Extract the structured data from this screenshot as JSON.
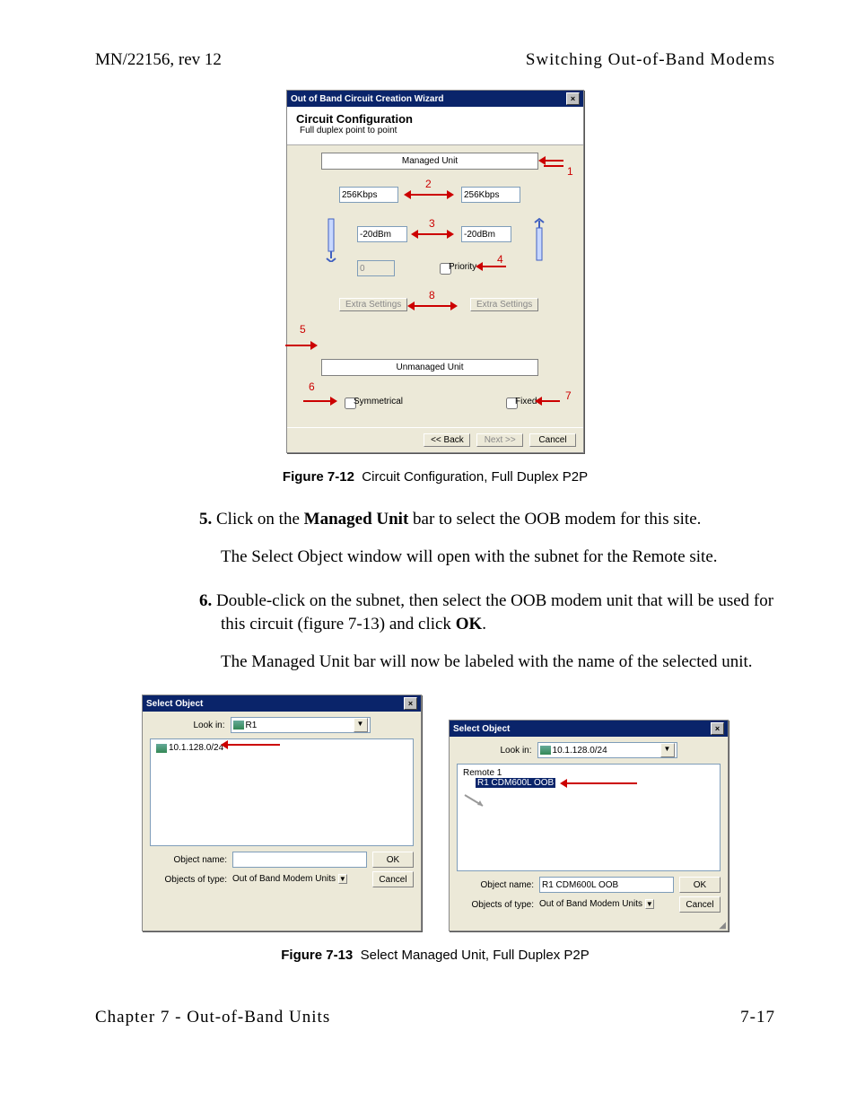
{
  "header": {
    "left": "MN/22156, rev 12",
    "right": "Switching Out-of-Band Modems"
  },
  "fig712": {
    "window_title": "Out of Band Circuit Creation Wizard",
    "title": "Circuit Configuration",
    "subtitle": "Full duplex point to point",
    "managed_unit_label": "Managed Unit",
    "unmanaged_unit_label": "Unmanaged Unit",
    "rate_left": "256Kbps",
    "rate_right": "256Kbps",
    "power_left": "-20dBm",
    "power_right": "-20dBm",
    "priority_value": "0",
    "priority_label": "Priority",
    "extra_left": "Extra Settings",
    "extra_right": "Extra Settings",
    "symmetrical_label": "Symmetrical",
    "fixed_label": "Fixed",
    "back_btn": "<< Back",
    "next_btn": "Next >>",
    "cancel_btn": "Cancel",
    "callouts": {
      "n1": "1",
      "n2": "2",
      "n3": "3",
      "n4": "4",
      "n5": "5",
      "n6": "6",
      "n7": "7",
      "n8": "8"
    }
  },
  "cap712": {
    "label": "Figure 7-12",
    "text": "Circuit Configuration, Full Duplex P2P"
  },
  "step5": {
    "num": "5.",
    "text_a": "Click on the ",
    "bold": "Managed Unit",
    "text_b": " bar to select the OOB modem for this site.",
    "follow": "The Select Object window will open with the subnet for the Remote site."
  },
  "step6": {
    "num": "6.",
    "text_a": "Double-click on the subnet, then select the OOB modem unit that will be used for this circuit (figure 7-13) and click ",
    "bold": "OK",
    "text_b": ".",
    "follow": "The Managed Unit bar will now be labeled with the name of the selected unit."
  },
  "fig713": {
    "window_title": "Select Object",
    "lookin_label": "Look in:",
    "left": {
      "lookin_value": "R1",
      "list_item": "10.1.128.0/24",
      "object_name_label": "Object name:",
      "object_name_value": "",
      "objects_type_label": "Objects of type:",
      "objects_type_value": "Out of Band Modem Units",
      "ok": "OK",
      "cancel": "Cancel"
    },
    "right": {
      "lookin_value": "10.1.128.0/24",
      "tree_parent": "Remote 1",
      "tree_child": "R1 CDM600L OOB",
      "object_name_label": "Object name:",
      "object_name_value": "R1 CDM600L OOB",
      "objects_type_label": "Objects of type:",
      "objects_type_value": "Out of Band Modem Units",
      "ok": "OK",
      "cancel": "Cancel"
    }
  },
  "cap713": {
    "label": "Figure 7-13",
    "text": "Select Managed Unit, Full Duplex P2P"
  },
  "footer": {
    "left": "Chapter 7 - Out-of-Band Units",
    "right": "7-17"
  }
}
